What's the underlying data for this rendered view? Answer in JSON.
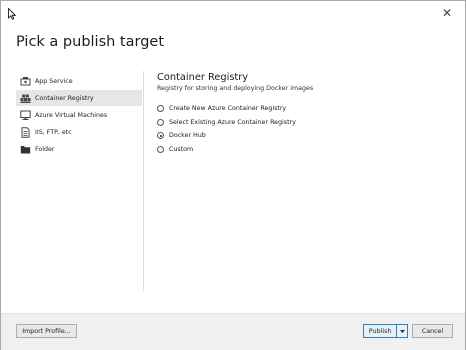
{
  "dialog": {
    "title": "Pick a publish target",
    "close_glyph": "✕"
  },
  "sidebar": {
    "items": [
      {
        "label": "App Service",
        "icon": "app-service-icon",
        "selected": false
      },
      {
        "label": "Container Registry",
        "icon": "container-registry-icon",
        "selected": true
      },
      {
        "label": "Azure Virtual Machines",
        "icon": "virtual-machine-icon",
        "selected": false
      },
      {
        "label": "IIS, FTP, etc",
        "icon": "document-icon",
        "selected": false
      },
      {
        "label": "Folder",
        "icon": "folder-icon",
        "selected": false
      }
    ]
  },
  "content": {
    "title": "Container Registry",
    "subtitle": "Registry for storing and deploying Docker images",
    "options": [
      {
        "label": "Create New Azure Container Registry",
        "checked": false
      },
      {
        "label": "Select Existing Azure Container Registry",
        "checked": false
      },
      {
        "label": "Docker Hub",
        "checked": true
      },
      {
        "label": "Custom",
        "checked": false
      }
    ]
  },
  "footer": {
    "import_label": "Import Profile...",
    "publish_label": "Publish",
    "cancel_label": "Cancel"
  },
  "colors": {
    "accent": "#3c7fb1",
    "selected_bg": "#e6e6e6"
  }
}
